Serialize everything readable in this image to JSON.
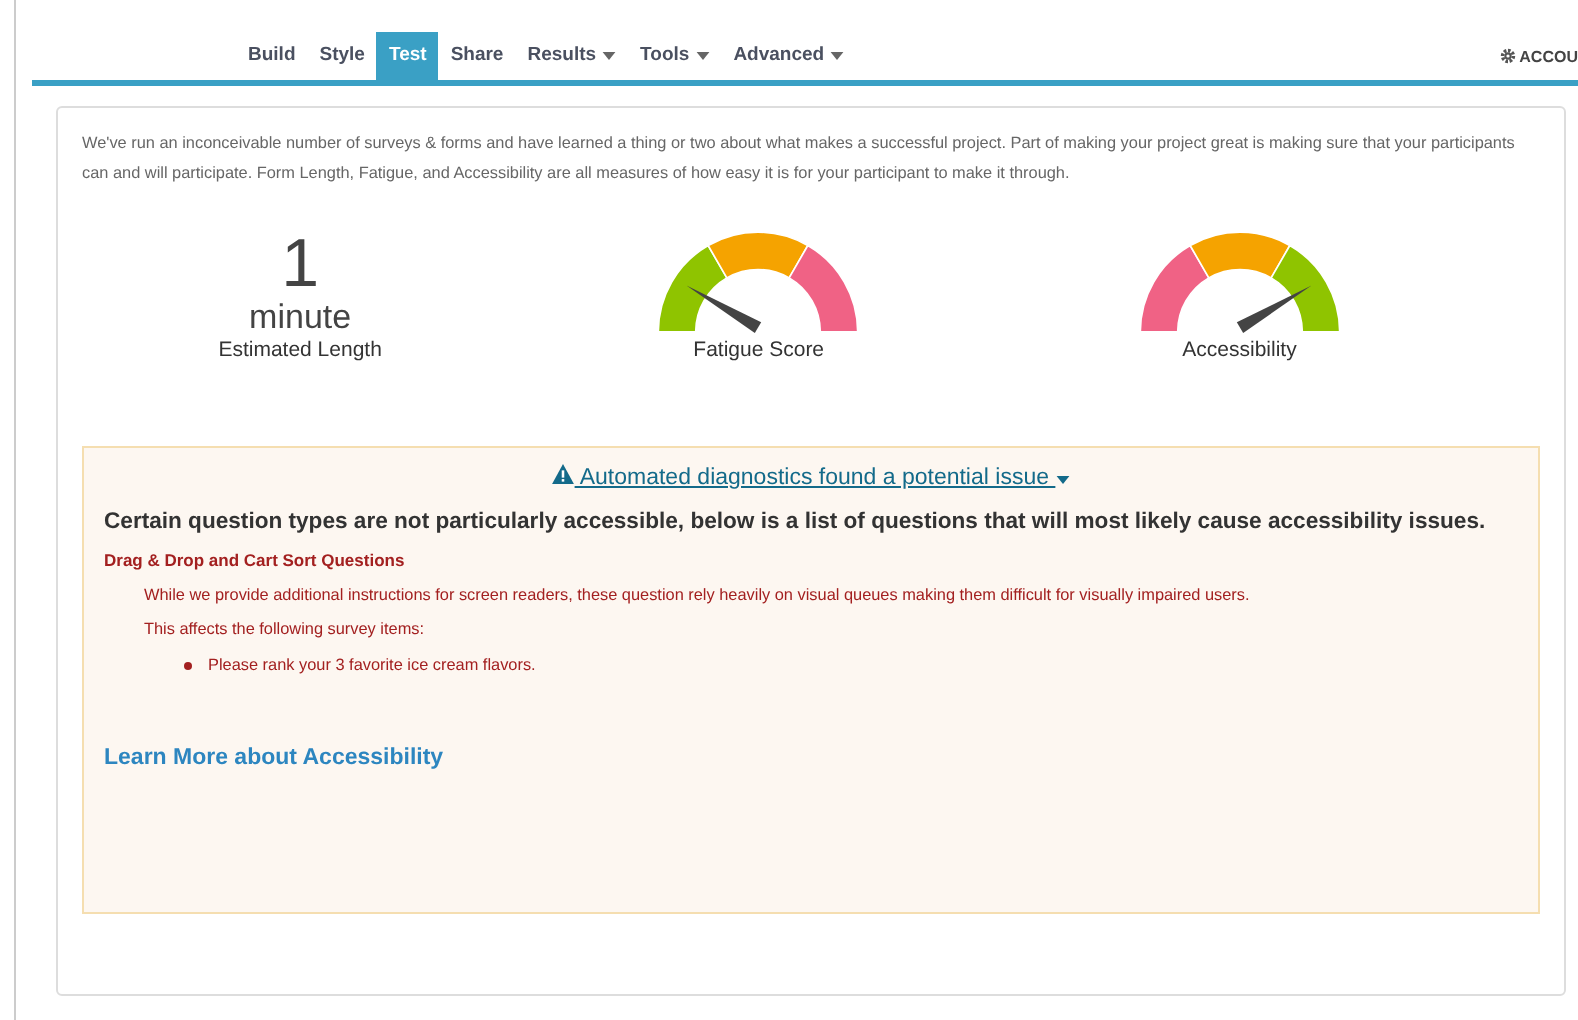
{
  "nav": {
    "tabs": [
      {
        "label": "Build",
        "selected": false,
        "dropdown": false
      },
      {
        "label": "Style",
        "selected": false,
        "dropdown": false
      },
      {
        "label": "Test",
        "selected": true,
        "dropdown": false
      },
      {
        "label": "Share",
        "selected": false,
        "dropdown": false
      },
      {
        "label": "Results",
        "selected": false,
        "dropdown": true
      },
      {
        "label": "Tools",
        "selected": false,
        "dropdown": true
      },
      {
        "label": "Advanced",
        "selected": false,
        "dropdown": true
      }
    ],
    "account": "ACCOU"
  },
  "intro": "We've run an inconceivable number of surveys & forms and have learned a thing or two about what makes a successful project. Part of making your project great is making sure that your participants can and will participate. Form Length, Fatigue, and Accessibility are all measures of how easy it is for your participant to make it through.",
  "length": {
    "value": "1",
    "unit": "minute",
    "label": "Estimated Length"
  },
  "gauges": [
    {
      "label": "Fatigue Score"
    },
    {
      "label": "Accessibility"
    }
  ],
  "diagnostics": {
    "toggle": "Automated diagnostics found a potential issue",
    "heading": "Certain question types are not particularly accessible, below is a list of questions that will most likely cause accessibility issues.",
    "issues": [
      {
        "title": "Drag & Drop and Cart Sort Questions",
        "description": "While we provide additional instructions for screen readers, these question rely heavily on visual queues making them difficult for visually impaired users.",
        "affects": "This affects the following survey items:",
        "items": [
          "Please rank your 3 favorite ice cream flavors."
        ]
      }
    ],
    "link": "Learn More about Accessibility"
  }
}
